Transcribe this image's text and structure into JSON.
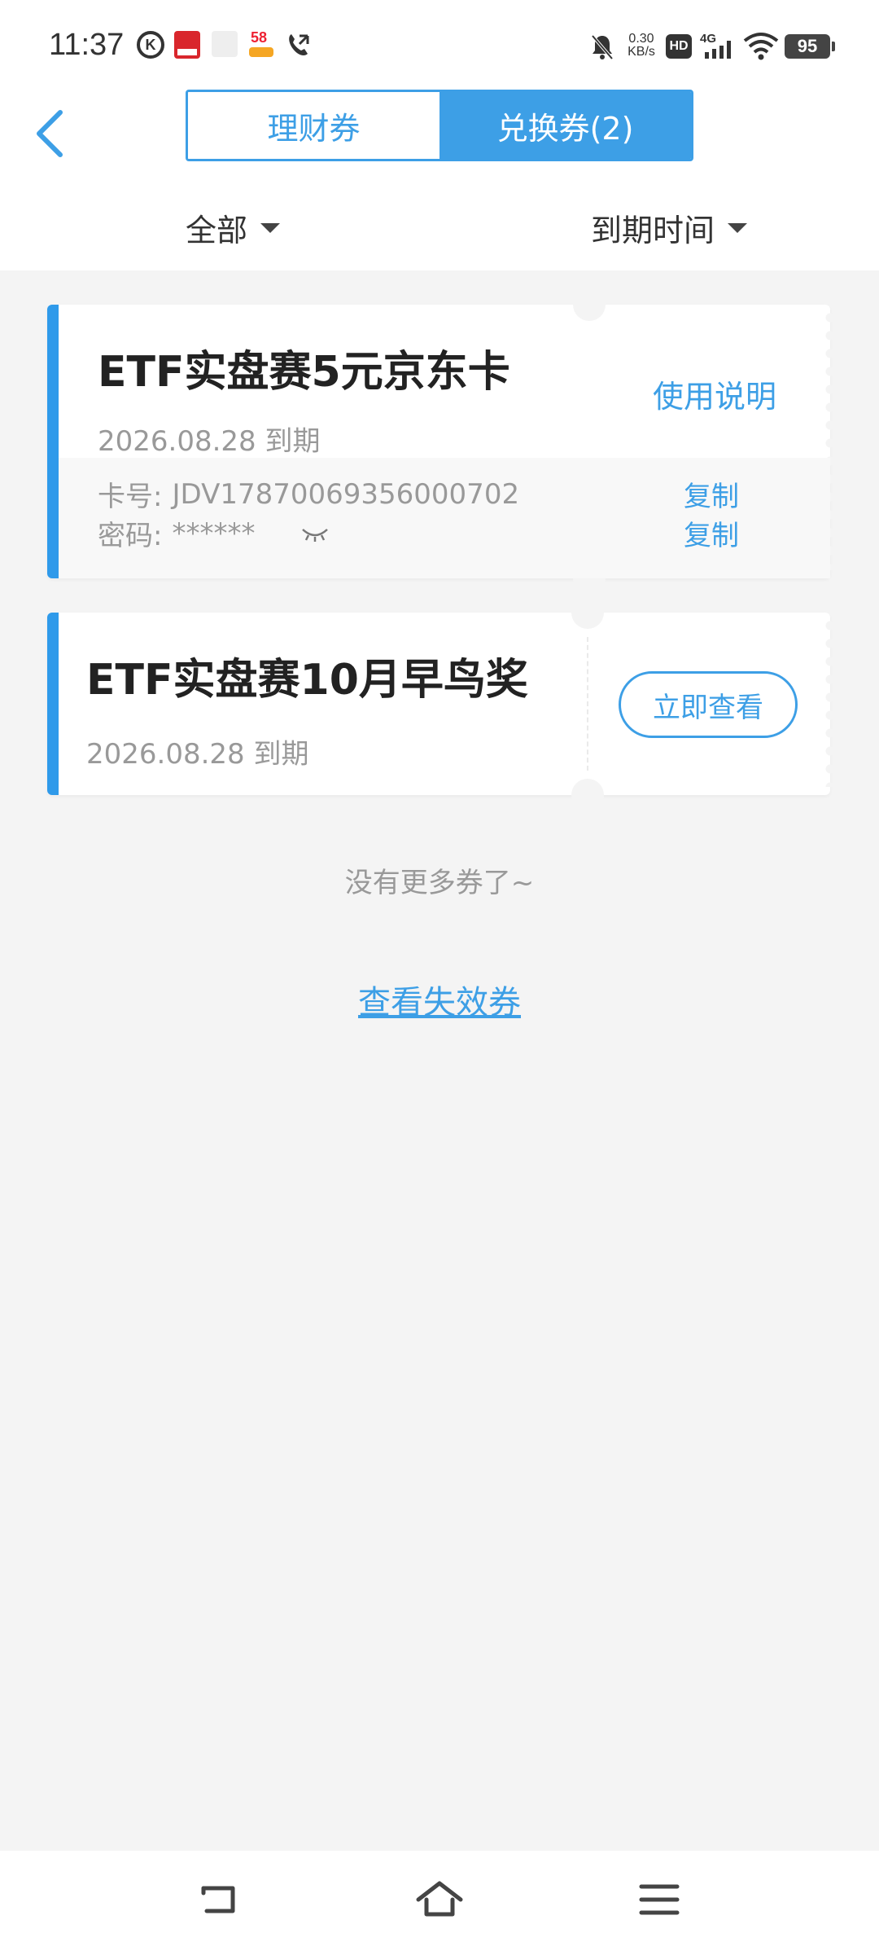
{
  "status_bar": {
    "time": "11:37",
    "network_speed": "0.30",
    "network_unit": "KB/s",
    "hd": "HD",
    "signal": "4G",
    "battery": "95"
  },
  "header": {
    "tabs": [
      {
        "label": "理财券",
        "active": false
      },
      {
        "label": "兑换券(2)",
        "active": true
      }
    ]
  },
  "filters": {
    "category": "全部",
    "sort": "到期时间"
  },
  "coupons": [
    {
      "title": "ETF实盘赛5元京东卡",
      "expiry": "2026.08.28 到期",
      "action": "使用说明",
      "card_label": "卡号:",
      "card_number": "JDV17870069356000702",
      "password_label": "密码:",
      "password": "******",
      "copy_label": "复制"
    },
    {
      "title": "ETF实盘赛10月早鸟奖",
      "expiry": "2026.08.28 到期",
      "action": "立即查看"
    }
  ],
  "footer": {
    "no_more": "没有更多券了~",
    "view_expired": "查看失效券"
  },
  "colors": {
    "accent": "#3d9fe6",
    "background": "#f4f4f4",
    "muted_text": "#999999"
  }
}
